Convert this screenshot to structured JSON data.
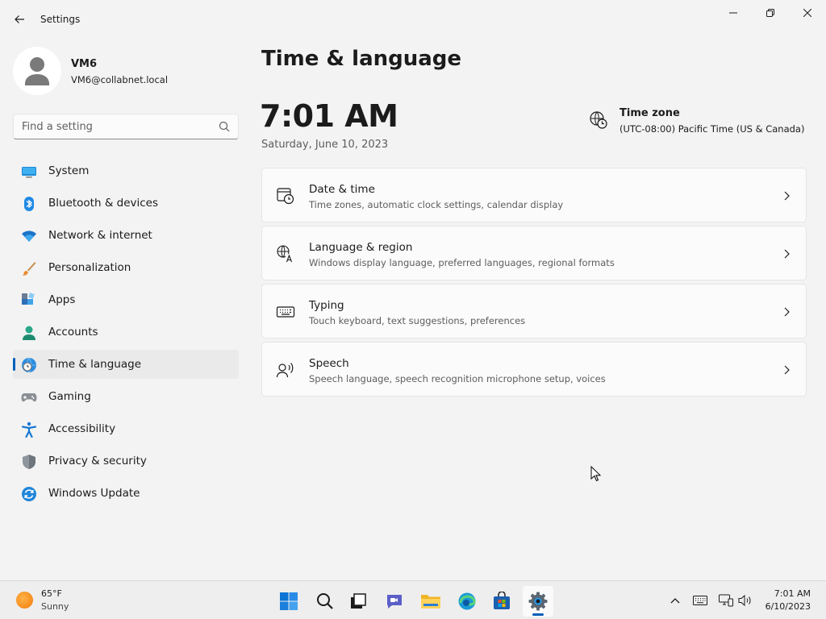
{
  "window": {
    "app_title": "Settings",
    "back_icon": "arrow-left-icon",
    "minimize_icon": "minimize-icon",
    "maximize_icon": "restore-icon",
    "close_icon": "close-icon"
  },
  "profile": {
    "name": "VM6",
    "email": "VM6@collabnet.local",
    "avatar_icon": "person-avatar-icon"
  },
  "search": {
    "placeholder": "Find a setting",
    "value": "",
    "icon": "search-icon"
  },
  "sidebar": {
    "items": [
      {
        "label": "System",
        "icon": "monitor-icon",
        "active": false
      },
      {
        "label": "Bluetooth & devices",
        "icon": "bluetooth-icon",
        "active": false
      },
      {
        "label": "Network & internet",
        "icon": "wifi-icon",
        "active": false
      },
      {
        "label": "Personalization",
        "icon": "paintbrush-icon",
        "active": false
      },
      {
        "label": "Apps",
        "icon": "apps-icon",
        "active": false
      },
      {
        "label": "Accounts",
        "icon": "accounts-icon",
        "active": false
      },
      {
        "label": "Time & language",
        "icon": "globe-clock-icon",
        "active": true
      },
      {
        "label": "Gaming",
        "icon": "gamepad-icon",
        "active": false
      },
      {
        "label": "Accessibility",
        "icon": "accessibility-icon",
        "active": false
      },
      {
        "label": "Privacy & security",
        "icon": "shield-icon",
        "active": false
      },
      {
        "label": "Windows Update",
        "icon": "windows-update-icon",
        "active": false
      }
    ]
  },
  "main": {
    "page_title": "Time & language",
    "clock": "7:01 AM",
    "date": "Saturday, June 10, 2023",
    "timezone": {
      "title": "Time zone",
      "value": "(UTC-08:00) Pacific Time (US & Canada)",
      "icon": "globe-clock-icon"
    },
    "cards": [
      {
        "title": "Date & time",
        "subtitle": "Time zones, automatic clock settings, calendar display",
        "icon": "calendar-clock-icon"
      },
      {
        "title": "Language & region",
        "subtitle": "Windows display language, preferred languages, regional formats",
        "icon": "language-icon"
      },
      {
        "title": "Typing",
        "subtitle": "Touch keyboard, text suggestions, preferences",
        "icon": "keyboard-icon"
      },
      {
        "title": "Speech",
        "subtitle": "Speech language, speech recognition microphone setup, voices",
        "icon": "speech-icon"
      }
    ]
  },
  "taskbar": {
    "weather": {
      "temp": "65°F",
      "condition": "Sunny",
      "icon": "sun-icon"
    },
    "apps": [
      {
        "name": "Start",
        "icon": "windows-start-icon"
      },
      {
        "name": "Search",
        "icon": "search-icon"
      },
      {
        "name": "Task View",
        "icon": "task-view-icon"
      },
      {
        "name": "Chat",
        "icon": "chat-icon"
      },
      {
        "name": "File Explorer",
        "icon": "folder-icon"
      },
      {
        "name": "Edge",
        "icon": "edge-icon"
      },
      {
        "name": "Store",
        "icon": "store-icon"
      },
      {
        "name": "Settings",
        "icon": "gear-icon"
      }
    ],
    "tray": {
      "chevron_icon": "chevron-up-icon",
      "keyboard_icon": "keyboard-icon",
      "network_icon": "network-icon",
      "volume_icon": "volume-icon",
      "time": "7:01 AM",
      "date": "6/10/2023"
    }
  },
  "colors": {
    "accent": "#005fb8",
    "background": "#f3f3f3",
    "card": "#fbfbfb"
  }
}
